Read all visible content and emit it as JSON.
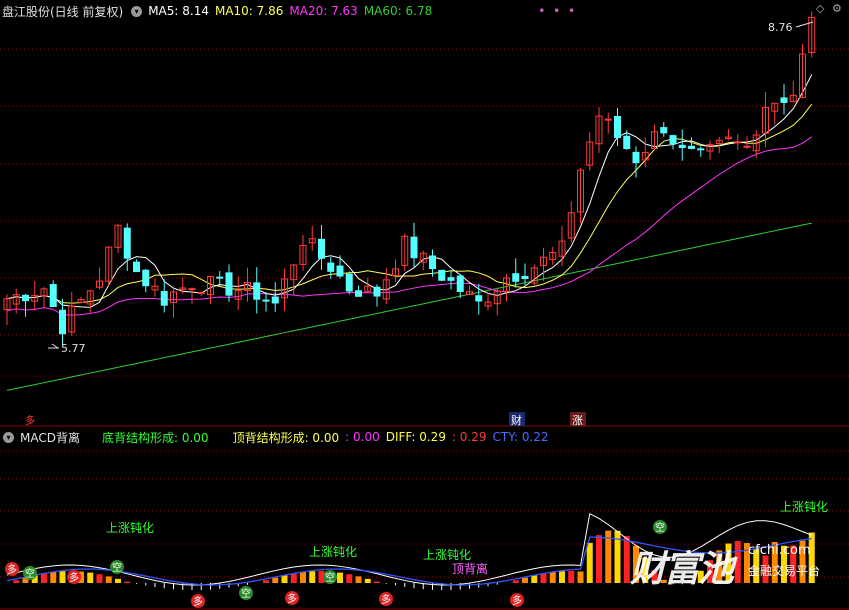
{
  "top": {
    "title": "盘江股份(日线 前复权)",
    "ma5": "MA5: 8.14",
    "ma10": "MA10: 7.86",
    "ma20": "MA20: 7.63",
    "ma60": "MA60: 6.78",
    "dots": "•     •     •"
  },
  "main_chart": {
    "high_label": "8.76",
    "low_label": "5.77",
    "tags": {
      "left": "多",
      "cai": "财",
      "zhang": "涨"
    }
  },
  "macd": {
    "name": "MACD背离",
    "bottom_div": "底背结构形成: 0.00",
    "top_div": "顶背结构形成: 0.00",
    "val1": ": 0.00",
    "diff": "DIFF: 0.29",
    "val2": ": 0.29",
    "cty": "CTY: 0.22",
    "labels": [
      "上涨钝化",
      "上涨钝化",
      "上涨钝化",
      "顶背离",
      "上涨钝化"
    ],
    "kong": "空",
    "duo": "多"
  },
  "watermark": {
    "brand": "财富池",
    "site": "cfchi.com",
    "sub": "金融交易平台"
  },
  "colors": {
    "up": "#ff3b3b",
    "down": "#54ffff",
    "ma5": "#ffffff",
    "ma10": "#ffff55",
    "ma20": "#ff33ff",
    "ma60": "#33cc33",
    "grid": "#8b0000"
  }
}
